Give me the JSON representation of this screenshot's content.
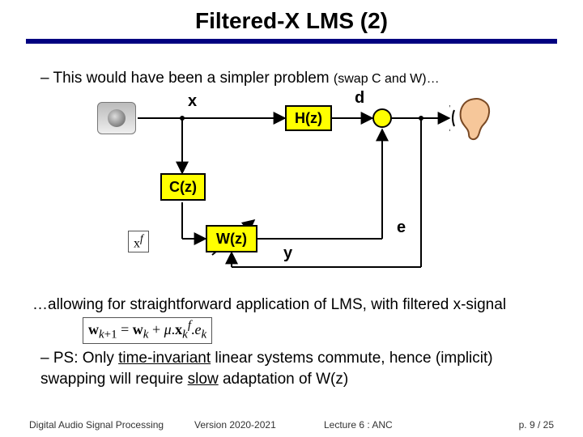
{
  "title": "Filtered-X LMS (2)",
  "bullet1_prefix": "– This would have been a simpler problem ",
  "bullet1_tail": "(swap C and W)…",
  "bullet2": "…allowing for straightforward application of LMS, with filtered x-signal",
  "bullet3_prefix": "– PS: Only ",
  "bullet3_u1": "time-invariant",
  "bullet3_mid": " linear systems commute, hence (implicit) swapping will require ",
  "bullet3_u2": "slow",
  "bullet3_suffix": " adaptation of W(z)",
  "labels": {
    "x": "x",
    "d": "d",
    "y": "y",
    "e": "e",
    "Hz": "H(z)",
    "Cz": "C(z)",
    "Wz": "W(z)",
    "xf_html": "x<sup><i>f</i></sup>"
  },
  "formula_html": "<b>w</b><sub><i>k</i>+1</sub> = <b>w</b><sub><i>k</i></sub> + <i>&mu;</i>.<b>x</b><sub><i>k</i></sub><sup><i>f</i></sup>.<i>e</i><sub><i>k</i></sub>",
  "footer": {
    "course": "Digital Audio Signal Processing",
    "version": "Version 2020-2021",
    "lecture": "Lecture 6 : ANC",
    "page": "p. 9 / 25"
  },
  "colors": {
    "underline": "#000080",
    "block_fill": "#ffff00"
  }
}
